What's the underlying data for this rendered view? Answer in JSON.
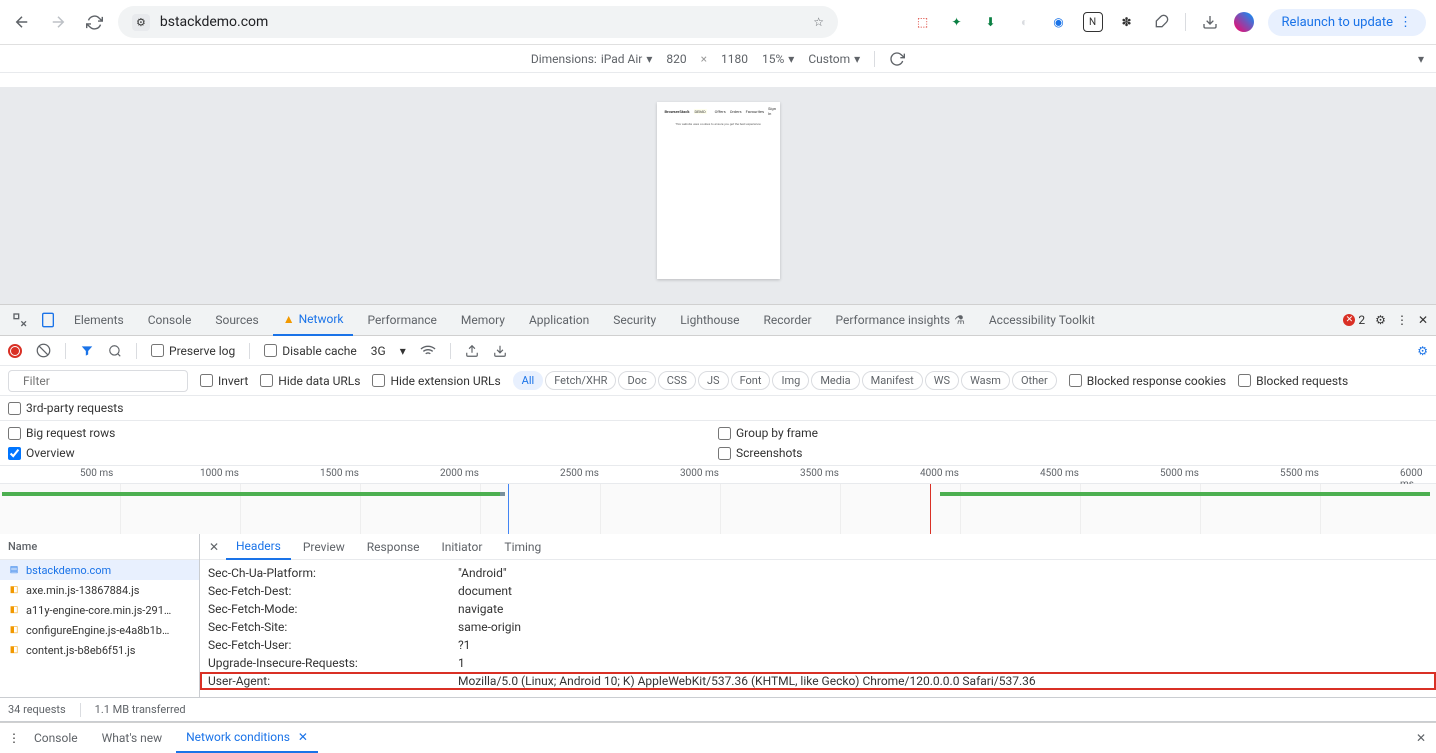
{
  "browser": {
    "url": "bstackdemo.com",
    "relaunch": "Relaunch to update"
  },
  "device_bar": {
    "dimensions_label": "Dimensions:",
    "device": "iPad Air",
    "width": "820",
    "height": "1180",
    "zoom": "15%",
    "custom": "Custom"
  },
  "devtools_tabs": [
    "Elements",
    "Console",
    "Sources",
    "Network",
    "Performance",
    "Memory",
    "Application",
    "Security",
    "Lighthouse",
    "Recorder",
    "Performance insights",
    "Accessibility Toolkit"
  ],
  "devtools_active": "Network",
  "error_count": "2",
  "net_toolbar": {
    "preserve_log": "Preserve log",
    "disable_cache": "Disable cache",
    "throttling": "3G"
  },
  "filter": {
    "placeholder": "Filter",
    "invert": "Invert",
    "hide_data": "Hide data URLs",
    "hide_ext": "Hide extension URLs",
    "types": [
      "All",
      "Fetch/XHR",
      "Doc",
      "CSS",
      "JS",
      "Font",
      "Img",
      "Media",
      "Manifest",
      "WS",
      "Wasm",
      "Other"
    ],
    "type_active": "All",
    "blocked_cookies": "Blocked response cookies",
    "blocked_req": "Blocked requests",
    "third_party": "3rd-party requests"
  },
  "options": {
    "big_rows": "Big request rows",
    "overview": "Overview",
    "group_frame": "Group by frame",
    "screenshots": "Screenshots"
  },
  "timeline_labels": [
    "500 ms",
    "1000 ms",
    "1500 ms",
    "2000 ms",
    "2500 ms",
    "3000 ms",
    "3500 ms",
    "4000 ms",
    "4500 ms",
    "5000 ms",
    "5500 ms",
    "6000 ms"
  ],
  "requests": {
    "header": "Name",
    "items": [
      {
        "name": "bstackdemo.com",
        "type": "doc"
      },
      {
        "name": "axe.min.js-13867884.js",
        "type": "js"
      },
      {
        "name": "a11y-engine-core.min.js-291…",
        "type": "js"
      },
      {
        "name": "configureEngine.js-e4a8b1b…",
        "type": "js"
      },
      {
        "name": "content.js-b8eb6f51.js",
        "type": "js"
      }
    ]
  },
  "detail_tabs": [
    "Headers",
    "Preview",
    "Response",
    "Initiator",
    "Timing"
  ],
  "detail_active": "Headers",
  "headers": [
    {
      "k": "Sec-Ch-Ua-Platform:",
      "v": "\"Android\""
    },
    {
      "k": "Sec-Fetch-Dest:",
      "v": "document"
    },
    {
      "k": "Sec-Fetch-Mode:",
      "v": "navigate"
    },
    {
      "k": "Sec-Fetch-Site:",
      "v": "same-origin"
    },
    {
      "k": "Sec-Fetch-User:",
      "v": "?1"
    },
    {
      "k": "Upgrade-Insecure-Requests:",
      "v": "1"
    },
    {
      "k": "User-Agent:",
      "v": "Mozilla/5.0 (Linux; Android 10; K) AppleWebKit/537.36 (KHTML, like Gecko) Chrome/120.0.0.0 Safari/537.36"
    }
  ],
  "status": {
    "requests": "34 requests",
    "transferred": "1.1 MB transferred"
  },
  "drawer": {
    "tabs": [
      "Console",
      "What's new",
      "Network conditions"
    ],
    "active": "Network conditions"
  }
}
